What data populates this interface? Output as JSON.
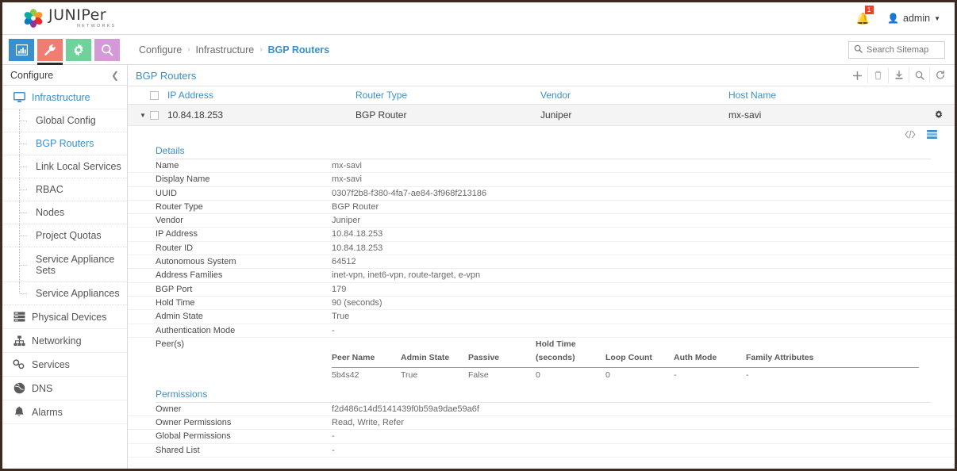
{
  "brand": {
    "name": "JUNIPer",
    "tagline": "NETWORKS"
  },
  "topbar": {
    "notifications_count": "1",
    "bell_icon": "bell-icon",
    "user_icon": "user-icon",
    "user_label": "admin",
    "caret_icon": "chevron-down-icon"
  },
  "tiles": [
    {
      "name": "monitor-tile",
      "icon": "bar-chart-icon",
      "color": "#3a90cf",
      "active": false
    },
    {
      "name": "configure-tile",
      "icon": "wrench-icon",
      "color": "#f07c72",
      "active": true
    },
    {
      "name": "settings-tile",
      "icon": "gear-icon",
      "color": "#6ed29a",
      "active": false
    },
    {
      "name": "query-tile",
      "icon": "search-icon",
      "color": "#d49ad8",
      "active": false
    }
  ],
  "breadcrumb": {
    "items": [
      "Configure",
      "Infrastructure",
      "BGP Routers"
    ],
    "separator": "›"
  },
  "sitemap_search": {
    "icon": "search-icon",
    "placeholder": "Search Sitemap",
    "value": ""
  },
  "sidebar": {
    "header": "Configure",
    "collapse_icon": "chevron-left-icon",
    "group": {
      "label": "Infrastructure",
      "icon": "monitor-icon"
    },
    "sub_items": [
      "Global Config",
      "BGP Routers",
      "Link Local Services",
      "RBAC",
      "Nodes",
      "Project Quotas",
      "Service Appliance Sets",
      "Service Appliances"
    ],
    "selected_sub": "BGP Routers",
    "items": [
      {
        "label": "Physical Devices",
        "icon": "servers-icon"
      },
      {
        "label": "Networking",
        "icon": "sitemap-icon"
      },
      {
        "label": "Services",
        "icon": "link-icon"
      },
      {
        "label": "DNS",
        "icon": "globe-icon"
      },
      {
        "label": "Alarms",
        "icon": "bell-icon"
      }
    ]
  },
  "panel": {
    "title": "BGP Routers",
    "tools": [
      {
        "name": "add-button",
        "icon": "plus-icon",
        "glyph": "＋"
      },
      {
        "name": "delete-button",
        "icon": "trash-icon",
        "glyph": "🗑"
      },
      {
        "name": "import-button",
        "icon": "download-icon",
        "glyph": "⤓"
      },
      {
        "name": "search-button",
        "icon": "search-icon",
        "glyph": "🔍"
      },
      {
        "name": "refresh-button",
        "icon": "refresh-icon",
        "glyph": "↻"
      }
    ]
  },
  "grid": {
    "columns": [
      "IP Address",
      "Router Type",
      "Vendor",
      "Host Name"
    ],
    "rows": [
      {
        "expanded": true,
        "expand_icon": "caret-down-icon",
        "ip_address": "10.84.18.253",
        "router_type": "BGP Router",
        "vendor": "Juniper",
        "host_name": "mx-savi",
        "gear_icon": "gear-icon"
      }
    ]
  },
  "detail": {
    "view_tools": [
      {
        "name": "json-view-toggle",
        "label": "</>",
        "active": false
      },
      {
        "name": "table-view-toggle",
        "label": "≡",
        "active": true
      }
    ],
    "details_title": "Details",
    "details_rows": [
      {
        "label": "Name",
        "value": "mx-savi"
      },
      {
        "label": "Display Name",
        "value": "mx-savi"
      },
      {
        "label": "UUID",
        "value": "0307f2b8-f380-4fa7-ae84-3f968f213186"
      },
      {
        "label": "Router Type",
        "value": "BGP Router"
      },
      {
        "label": "Vendor",
        "value": "Juniper"
      },
      {
        "label": "IP Address",
        "value": "10.84.18.253"
      },
      {
        "label": "Router ID",
        "value": "10.84.18.253"
      },
      {
        "label": "Autonomous System",
        "value": "64512"
      },
      {
        "label": "Address Families",
        "value": "inet-vpn, inet6-vpn, route-target, e-vpn"
      },
      {
        "label": "BGP Port",
        "value": "179"
      },
      {
        "label": "Hold Time",
        "value": "90 (seconds)"
      },
      {
        "label": "Admin State",
        "value": "True"
      },
      {
        "label": "Authentication Mode",
        "value": "-"
      }
    ],
    "peers_label": "Peer(s)",
    "peers_columns": [
      "Peer Name",
      "Admin State",
      "Passive",
      "Hold Time",
      "(seconds)",
      "Loop Count",
      "Auth Mode",
      "Family Attributes"
    ],
    "peers_rows": [
      {
        "peer_name": "5b4s42",
        "admin_state": "True",
        "passive": "False",
        "hold_time": "0",
        "loop_count": "0",
        "auth_mode": "-",
        "family_attributes": "-"
      }
    ],
    "permissions_title": "Permissions",
    "permissions_rows": [
      {
        "label": "Owner",
        "value": "f2d486c14d5141439f0b59a9dae59a6f"
      },
      {
        "label": "Owner Permissions",
        "value": "Read, Write, Refer"
      },
      {
        "label": "Global Permissions",
        "value": "-"
      },
      {
        "label": "Shared List",
        "value": "-"
      }
    ]
  },
  "colors": {
    "accent_blue": "#3a90cf",
    "badge_red": "#e8452b",
    "tile_blue": "#3a90cf",
    "tile_red": "#f07c72",
    "tile_green": "#6ed29a",
    "tile_purple": "#d49ad8"
  }
}
